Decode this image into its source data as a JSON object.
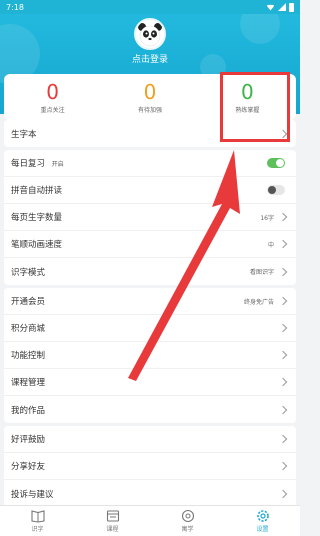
{
  "status_bar": {
    "time": "7:18"
  },
  "profile": {
    "login_text": "点击登录"
  },
  "stats": [
    {
      "value": "0",
      "label": "重点关注",
      "color": "#e8393b"
    },
    {
      "value": "0",
      "label": "有待加强",
      "color": "#f0a020"
    },
    {
      "value": "0",
      "label": "熟练掌握",
      "color": "#3db44a"
    }
  ],
  "section1": {
    "label": "生字本"
  },
  "settings": {
    "daily_review": {
      "label": "每日复习",
      "tag": "开启",
      "on": true
    },
    "auto_pinyin": {
      "label": "拼音自动拼读",
      "on": false
    },
    "chars_per_page": {
      "label": "每页生字数量",
      "value": "16字"
    },
    "stroke_speed": {
      "label": "笔顺动画速度",
      "value": "中"
    },
    "mode": {
      "label": "识字模式",
      "value": "看图识字"
    }
  },
  "menu": [
    {
      "label": "开通会员",
      "value": "终身免广告"
    },
    {
      "label": "积分商城"
    },
    {
      "label": "功能控制"
    },
    {
      "label": "课程管理"
    },
    {
      "label": "我的作品"
    }
  ],
  "menu2": [
    {
      "label": "好评鼓励"
    },
    {
      "label": "分享好友"
    },
    {
      "label": "投诉与建议"
    }
  ],
  "tabs": [
    {
      "label": "识字",
      "icon": "book-icon"
    },
    {
      "label": "课程",
      "icon": "course-icon"
    },
    {
      "label": "寓学",
      "icon": "compass-icon"
    },
    {
      "label": "设置",
      "icon": "gear-icon"
    }
  ],
  "colors": {
    "accent": "#1fa7d4",
    "header": "#1fb3d6",
    "highlight": "#e8393b",
    "toggle_on": "#5dc05a"
  }
}
